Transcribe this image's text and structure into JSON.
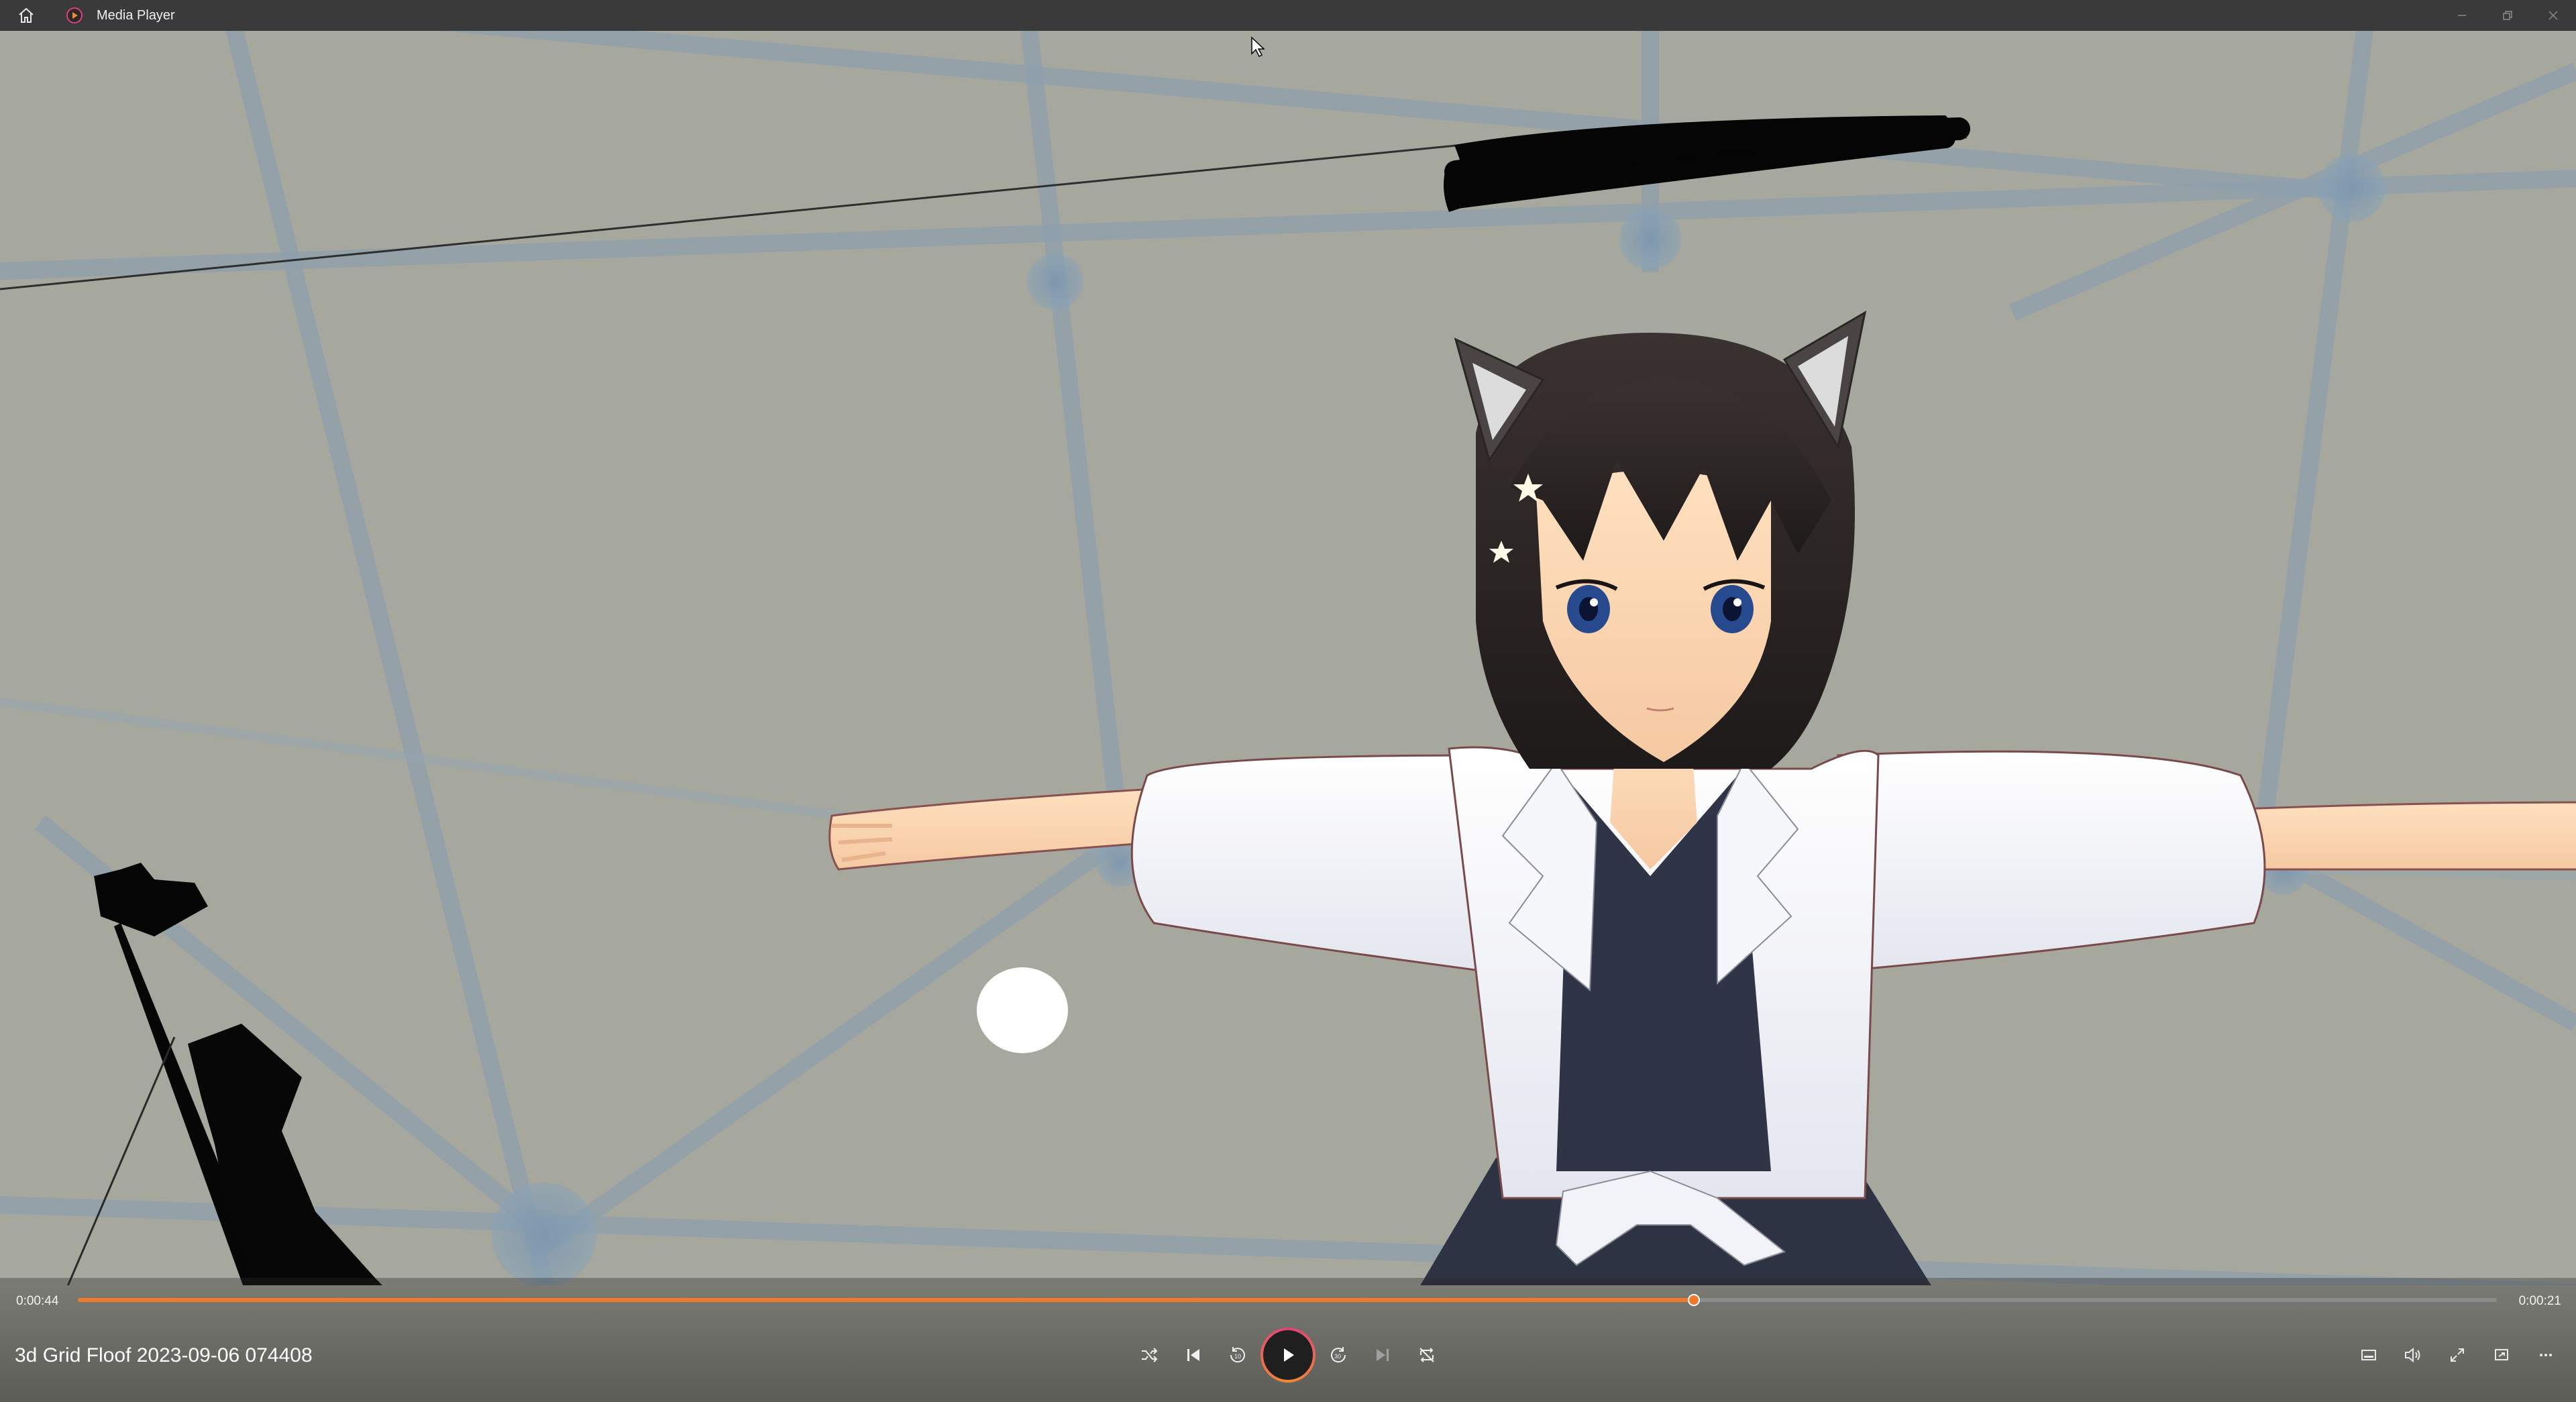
{
  "window": {
    "title": "Media Player"
  },
  "player": {
    "current_time": "0:00:44",
    "remaining_time": "0:00:21",
    "progress": 0.668,
    "file_name": "3d Grid Floof 2023-09-06 074408",
    "accent_color": "#f07a2a"
  },
  "controls": {
    "center": [
      "shuffle-icon",
      "previous-icon",
      "rewind-10-icon",
      "play-icon",
      "forward-30-icon",
      "next-icon",
      "repeat-off-icon"
    ],
    "right": [
      "miniplayer-icon",
      "volume-icon",
      "fullscreen-icon",
      "cast-icon",
      "more-icon"
    ]
  },
  "scene": {
    "background": "#a7a89d",
    "grid_color": "#8fa0ad",
    "character": "anime cat-ear girl in white shirt and dark dress, T-pose"
  }
}
